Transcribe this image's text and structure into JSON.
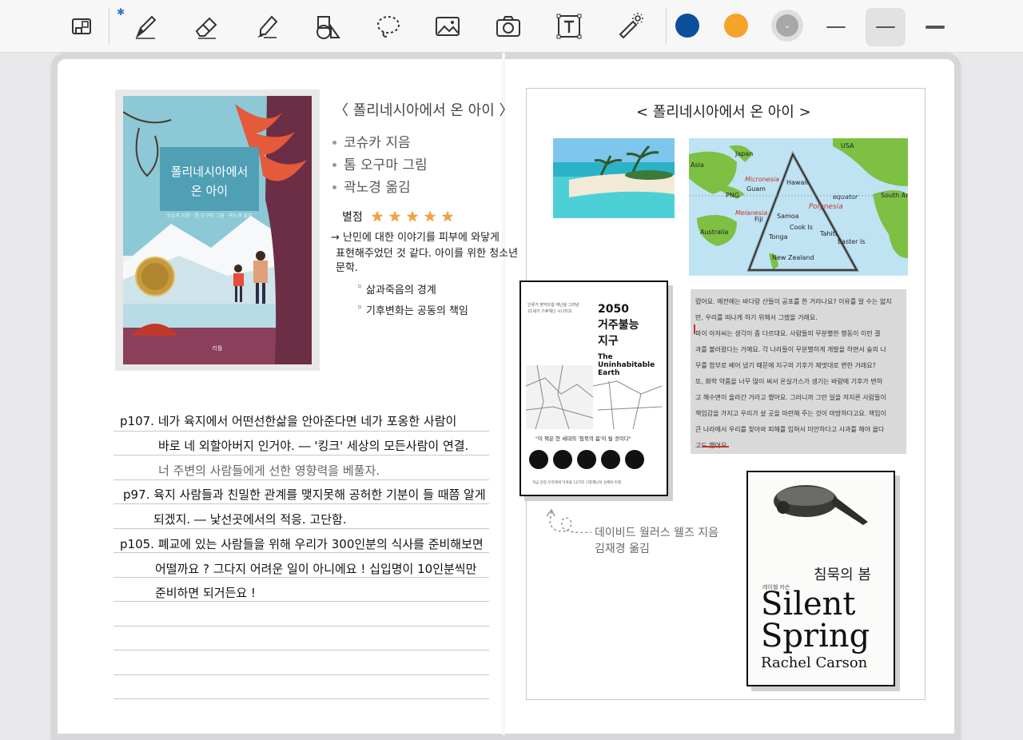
{
  "toolbar": {
    "bluetooth_glyph": "✱",
    "tools": [
      {
        "name": "page-layout-icon"
      },
      {
        "name": "pen-icon"
      },
      {
        "name": "eraser-icon"
      },
      {
        "name": "highlighter-icon"
      },
      {
        "name": "shapes-icon"
      },
      {
        "name": "lasso-icon"
      },
      {
        "name": "image-icon"
      },
      {
        "name": "camera-icon"
      },
      {
        "name": "text-box-icon"
      },
      {
        "name": "laser-pointer-icon"
      }
    ],
    "colors": [
      "#0b4f9c",
      "#f5a32a",
      "#a8a8a8"
    ],
    "stroke_sizes": [
      "thin",
      "medium",
      "thick"
    ]
  },
  "left_page": {
    "book_title": "〈 폴리네시아에서 온 아이 〉",
    "meta": [
      "코슈카 지음",
      "톰 오구마 그림",
      "곽노경 옮김"
    ],
    "rating_label": "별점",
    "stars": 5,
    "review_lines": [
      "→ 난민에 대한 이야기를 피부에 와닿게",
      "표현해주었던 것 같다. 아이를 위한 청소년",
      "문학."
    ],
    "bullets": [
      "삶과죽음의 경계",
      "기후변화는 공동의 책임"
    ],
    "cover": {
      "title_line1": "폴리네시아에서",
      "title_line2": "온 아이",
      "byline": "코슈카 지음 · 톰 오구마 그림 · 곽노경 옮김",
      "publisher": "리틀"
    },
    "notes": [
      "p107. 네가 육지에서 어떤선한삶을 안아준다면 네가 포옹한 사람이",
      "바로 네 외할아버지 인거야. ― '킹크' 세상의 모든사람이 연결.",
      "너 주변의 사람들에게 선한 영향력을 베풀자.",
      "p97. 육지 사람들과 친밀한 관계를 맺지못해 공허한 기분이 들 때쯤 알게",
      "되겠지. ― 낯선곳에서의 적응. 고단함.",
      "p105. 폐교에 있는 사람들을 위해 우리가 300인분의 식사를 준비해보면",
      "어떨까요 ? 그다지 어려운 일이 아니에요 ! 십입명이 10인분씩만",
      "준비하면 되거든요 !"
    ]
  },
  "right_page": {
    "title": "< 폴리네시아에서 온 아이 >",
    "map_labels": {
      "japan": "Japan",
      "usa": "USA",
      "asia": "Asia",
      "micronesia": "Micronesia",
      "hawaii": "Hawaii",
      "guam": "Guam",
      "png": "PNG",
      "equator": "equator",
      "south_america": "South America",
      "melanesia": "Melanesia",
      "polynesia": "Polynesia",
      "fiji": "Fiji",
      "samoa": "Samoa",
      "cook": "Cook Is",
      "tahiti": "Tahiti",
      "tonga": "Tonga",
      "australia": "Australia",
      "easter": "Easter Is",
      "nz": "New Zealand"
    },
    "book2050": {
      "top_note_1": "인류가 맞닥뜨릴 재난을 그려낸",
      "top_note_2": "21세기 기후재난 시나리오",
      "title_1": "2050",
      "title_2": "거주불능",
      "title_3": "지구",
      "en_1": "The",
      "en_2": "Uninhabitable",
      "en_3": "Earth",
      "quote": "\"이 책은 현 세대의 '침묵의 봄'이 될 것이다\"",
      "footer": "지금 당장 우리에게 닥쳐올 12가지 기후재난의 실체와 미래"
    },
    "attribution_1": "데이비드 월러스 웰즈 지음",
    "attribution_2": "김재경 옮김",
    "text_lines": [
      "렸어요. 예전에는 바다랑 산들이 공포를 한 거라나요? 이유를 알 수는 없지",
      "만, 우리를 떠나게 하기 위해서 그랬을 거래요.",
      "파이 아저씨는 생각이 좀 다르대요. 사람들의 무분별한 행동이 이런 결",
      "과를 불러왔다는 거예요. 각 나라들이 무분별하게 개발을 하면서 숲의 나",
      "무를 함부로 베어 냈기 때문에 지구의 기후가 제멋대로 변한 거래요?",
      "또, 화학 약품을 너무 많이 써서 온실가스가 생기는 바람에 기후가 변하",
      "고 해수면이 올라간 거라고 했어요. 그러니까 그런 일을 저지른 사람들이",
      "책임감을 가지고 우리가 살 곳을 마련해 주는 것이 마땅하다고요. 책임이",
      "큰 나라에서 우리를 찾아와 피해를 입혀서 미안하다고 사과를 해야 옳다",
      "고도 했어요."
    ],
    "silent_spring": {
      "korean_title": "침묵의 봄",
      "author_kr": "레이첼 카슨",
      "title_1": "Silent",
      "title_2": "Spring",
      "author": "Rachel Carson"
    }
  }
}
